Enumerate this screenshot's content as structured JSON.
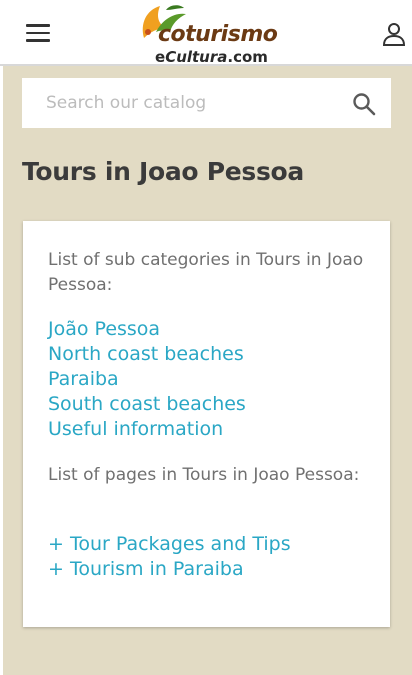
{
  "header": {
    "logo_top": "coturismo",
    "logo_bottom_e": "e",
    "logo_bottom_cultura": "Cultura",
    "logo_bottom_com": ".com",
    "menu_icon": "hamburger-menu-icon",
    "user_icon": "user-account-icon"
  },
  "search": {
    "placeholder": "Search our catalog",
    "value": "",
    "icon": "search-icon"
  },
  "page": {
    "title": "Tours in Joao Pessoa"
  },
  "card": {
    "subcategories_intro": "List of sub categories in Tours in Joao Pessoa:",
    "subcategories": [
      "João Pessoa",
      "North coast beaches",
      "Paraiba",
      "South coast beaches",
      "Useful information"
    ],
    "pages_intro": "List of pages in Tours in Joao Pessoa:",
    "pages": [
      "+ Tour Packages and Tips",
      "+ Tourism in Paraiba"
    ]
  },
  "colors": {
    "background": "#e2dbc4",
    "link": "#2aa7c5",
    "title": "#3b3b3b"
  }
}
